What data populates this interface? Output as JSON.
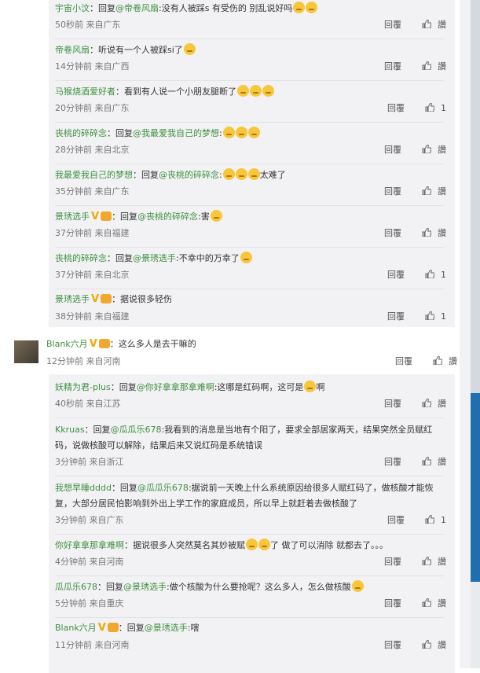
{
  "labels": {
    "reply": "回覆",
    "like": "讚"
  },
  "block1": [
    {
      "user": "宇宙小汶",
      "prefix": "：回复",
      "at": "@帝卷风扇",
      "text": ":没有人被踩s 有受伤的 别乱说好吗",
      "emoji_count": 2,
      "time": "50秒前 来自广东",
      "likes": "讚"
    },
    {
      "user": "帝卷风扇",
      "prefix": "",
      "at": "",
      "text": "：听说有一个人被踩si了",
      "emoji_count": 1,
      "time": "14分钟前 来自广西",
      "likes": "讚"
    },
    {
      "user": "马猴烧酒爱好者",
      "prefix": "",
      "at": "",
      "text": "：看到有人说一个小朋友腿断了",
      "emoji_count": 3,
      "time": "20分钟前 来自广东",
      "likes": "1"
    },
    {
      "user": "丧桃的碎碎念",
      "prefix": "：回复",
      "at": "@我最爱我自己的梦想",
      "text": ":",
      "emoji_count": 3,
      "time": "28分钟前 来自北京",
      "likes": "讚"
    },
    {
      "user": "我最爱我自己的梦想",
      "prefix": "：回复",
      "at": "@丧桃的碎碎念",
      "text": ":",
      "tail": "太难了",
      "emoji_count": 3,
      "time": "35分钟前 来自广东",
      "likes": "讚"
    },
    {
      "user": "景琇选手",
      "verified": "V",
      "prefix": "：回复",
      "at": "@丧桃的碎碎念",
      "text": ":害",
      "emoji_count": 1,
      "time": "37分钟前 来自福建",
      "likes": "讚"
    },
    {
      "user": "丧桃的碎碎念",
      "prefix": "：回复",
      "at": "@景琇选手",
      "text": ":不幸中的万幸了",
      "emoji_count": 1,
      "time": "37分钟前 来自北京",
      "likes": "1"
    },
    {
      "user": "景琇选手",
      "verified": "V",
      "prefix": "",
      "at": "",
      "text": "：据说很多轻伤",
      "emoji_count": 0,
      "time": "38分钟前 来自福建",
      "likes": "1"
    }
  ],
  "main_comment": {
    "user": "Blank六月",
    "verified": "V",
    "text": "：这么多人是去干嘛的",
    "time": "12分钟前 来自河南",
    "likes": "讚"
  },
  "block2": [
    {
      "user": "妖精为君-plus",
      "prefix": "：回复",
      "at": "@你好拿拿那拿难啊",
      "text": ":这哪是红码啊，这可是",
      "tail": "啊",
      "emoji_count": 1,
      "time": "40秒前 来自江苏",
      "likes": "讚"
    },
    {
      "user": "Kkruas",
      "prefix": "：回复",
      "at": "@瓜瓜乐678",
      "text": ":我看到的消息是当地有个阳了，要求全部居家两天，结果突然全员赋红码，说做核酸可以解除，结果后来又说红码是系统错误",
      "wrap": true,
      "emoji_count": 0,
      "time": "3分钟前 来自浙江",
      "likes": "讚"
    },
    {
      "user": "我想早睡dddd",
      "prefix": "：回复",
      "at": "@瓜瓜乐678",
      "text": ":据说前一天晚上什么系统原因给很多人赋红码了，做核酸才能恢复，大部分居民怕影响到外出上学工作的家庭成员，所以早上就赶着去做核酸了",
      "wrap": true,
      "emoji_count": 0,
      "time": "3分钟前 来自广东",
      "likes": "1"
    },
    {
      "user": "你好拿拿那拿难啊",
      "prefix": "",
      "at": "",
      "text": "：据说很多人突然莫名其妙被赋",
      "tail": "了 做了可以消除 就都去了。。。",
      "emoji_count": 2,
      "time": "4分钟前 来自河南",
      "likes": "讚"
    },
    {
      "user": "瓜瓜乐678",
      "prefix": "：回复",
      "at": "@景琇选手",
      "text": ":做个核酸为什么要抢呢？这么多人，怎么做核酸",
      "emoji_count": 1,
      "time": "5分钟前 来自重庆",
      "likes": "讚"
    },
    {
      "user": "Blank六月",
      "verified": "V",
      "prefix": "：回复",
      "at": "@景琇选手",
      "text": ":嗐",
      "emoji_count": 0,
      "time": "11分钟前 来自河南",
      "likes": "讚"
    }
  ]
}
